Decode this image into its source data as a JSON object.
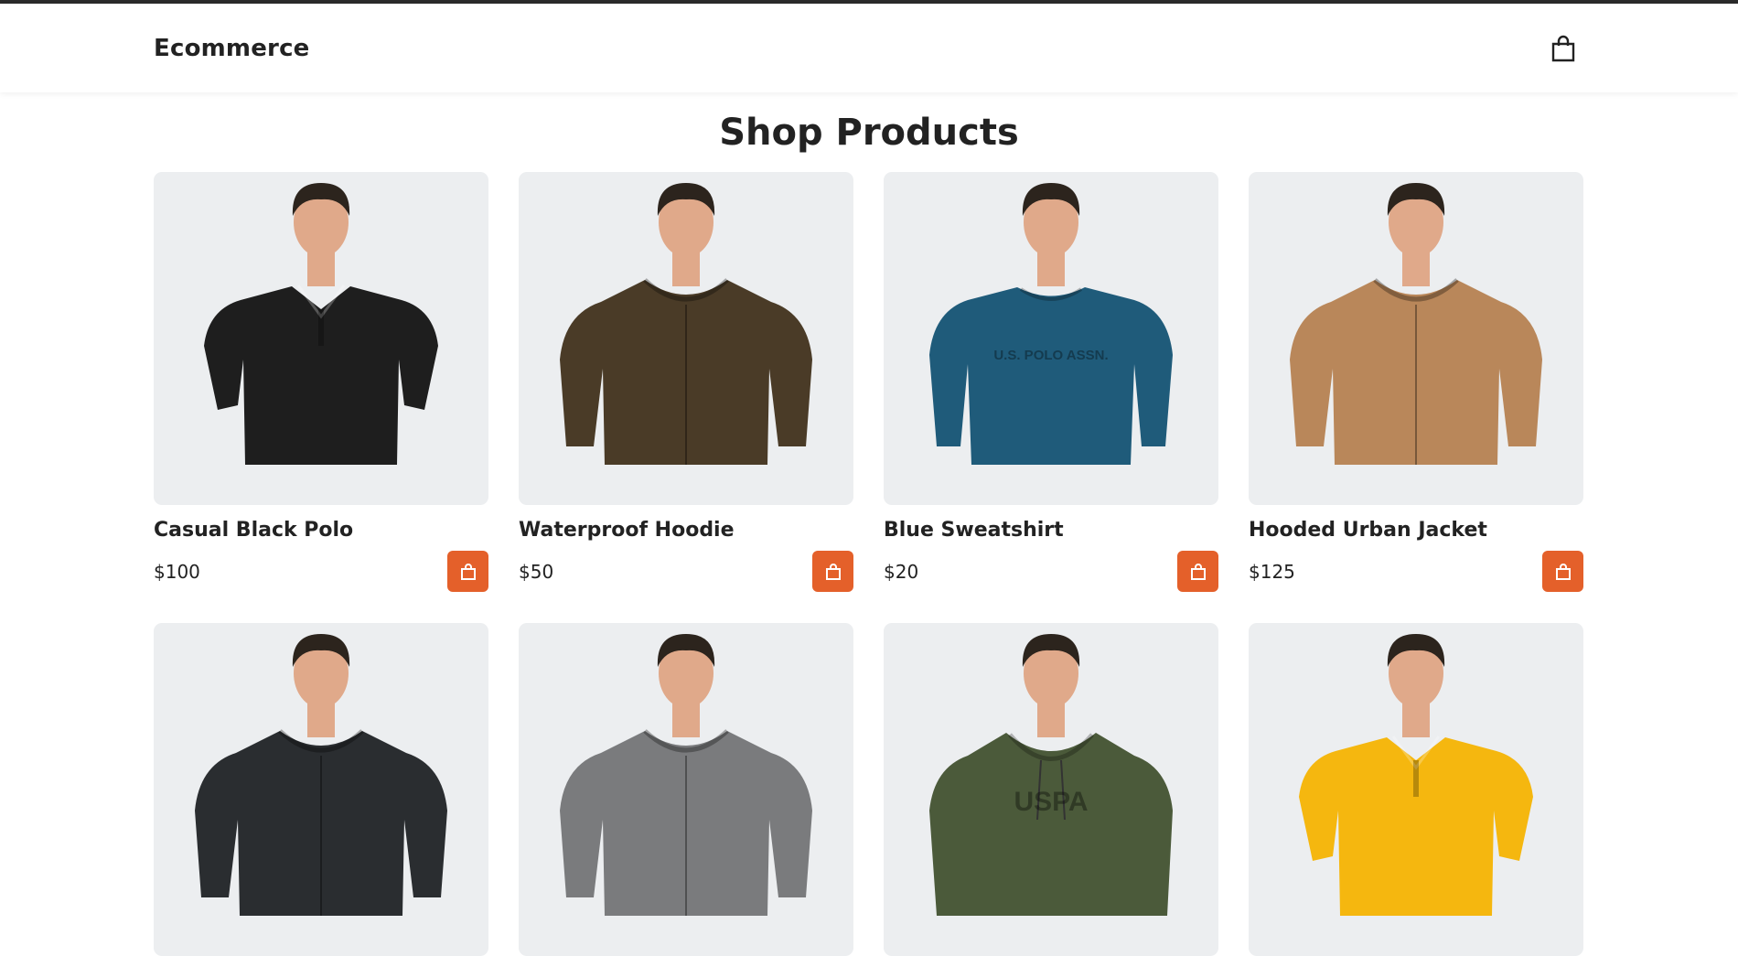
{
  "header": {
    "brand": "Ecommerce",
    "cart_icon": "shopping-bag-icon"
  },
  "main": {
    "title": "Shop Products"
  },
  "colors": {
    "accent": "#e4602a",
    "card_bg": "#eceef0",
    "text": "#222222"
  },
  "products": [
    {
      "name": "Casual Black Polo",
      "price": "$100",
      "garment": "#1e1e1e",
      "style": "polo",
      "print": ""
    },
    {
      "name": "Waterproof Hoodie",
      "price": "$50",
      "garment": "#4a3b27",
      "style": "jacket",
      "print": ""
    },
    {
      "name": "Blue Sweatshirt",
      "price": "$20",
      "garment": "#1f5b7a",
      "style": "sweat",
      "print": "U.S. POLO ASSN."
    },
    {
      "name": "Hooded Urban Jacket",
      "price": "$125",
      "garment": "#b9875a",
      "style": "jacket",
      "print": ""
    },
    {
      "name": "",
      "price": "",
      "garment": "#2a2d30",
      "style": "jacket",
      "print": ""
    },
    {
      "name": "",
      "price": "",
      "garment": "#7a7b7d",
      "style": "jacket",
      "print": ""
    },
    {
      "name": "",
      "price": "",
      "garment": "#4b5a3a",
      "style": "hoodie",
      "print": "USPA"
    },
    {
      "name": "",
      "price": "",
      "garment": "#f5b70f",
      "style": "polo",
      "print": ""
    }
  ]
}
